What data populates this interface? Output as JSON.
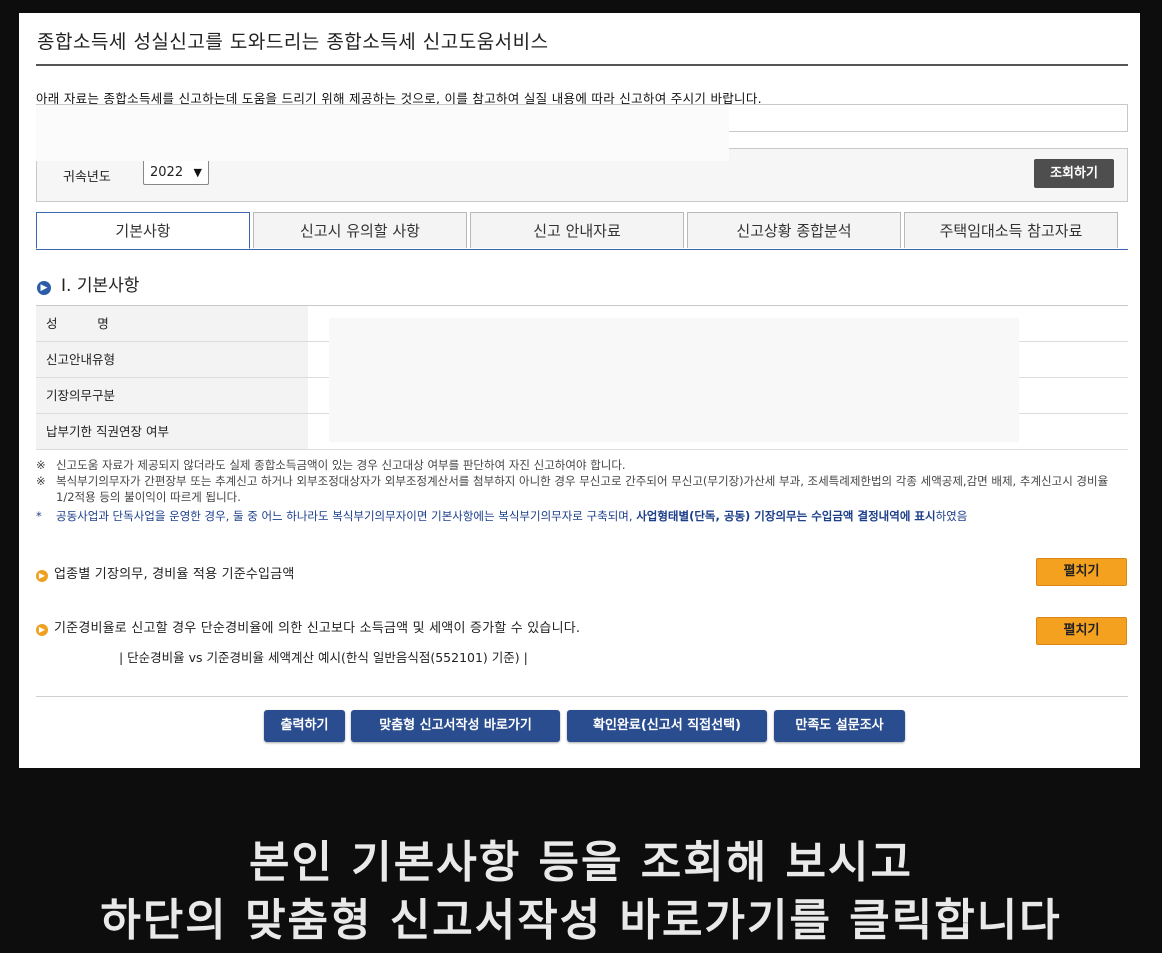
{
  "header": {
    "title": "종합소득세 성실신고를 도와드리는 종합소득세 신고도움서비스"
  },
  "notice": {
    "text": "아래 자료는 종합소득세를 신고하는데 도움을 드리기 위해 제공하는 것으로, 이를 참고하여 실질 내용에 따라 신고하여 주시기 바랍니다."
  },
  "search": {
    "year_label": "귀속년도",
    "year_value": "2022",
    "submit_label": "조회하기"
  },
  "tabs": [
    {
      "label": "기본사항",
      "active": true
    },
    {
      "label": "신고시 유의할 사항",
      "active": false
    },
    {
      "label": "신고 안내자료",
      "active": false
    },
    {
      "label": "신고상황 종합분석",
      "active": false
    },
    {
      "label": "주택임대소득 참고자료",
      "active": false
    }
  ],
  "section": {
    "title": "Ⅰ. 기본사항"
  },
  "basic_info": {
    "rows": [
      {
        "label": "성          명"
      },
      {
        "label": "신고안내유형"
      },
      {
        "label": "기장의무구분"
      },
      {
        "label": "납부기한 직권연장 여부"
      }
    ]
  },
  "notes": {
    "mark1": "※",
    "note1": "신고도움 자료가 제공되지 않더라도 실제 종합소득금액이 있는 경우 신고대상 여부를 판단하여 자진 신고하여야 합니다.",
    "mark2": "※",
    "note2": "복식부기의무자가 간편장부 또는 추계신고 하거나 외부조정대상자가 외부조정계산서를 첨부하지 아니한 경우 무신고로 간주되어 무신고(무기장)가산세 부과, 조세특례제한법의 각종 세액공제,감면 배제, 추계신고시 경비율 1/2적용 등의 불이익이 따르게 됩니다.",
    "mark3": "*",
    "note3_prefix": "공동사업과 단독사업을 운영한 경우, 둘 중 어느 하나라도 복식부기의무자이면 기본사항에는 복식부기의무자로 구축되며,",
    "note3_bold": "사업형태별(단독, 공동) 기장의무는 수입금액 결정내역에 표시",
    "note3_suffix": "하였음"
  },
  "expense_section": {
    "title": "업종별 기장의무, 경비율 적용 기준수입금액",
    "button_label": "펼치기"
  },
  "standard_rate_section": {
    "title": "기준경비율로 신고할 경우 단순경비율에 의한 신고보다 소득금액 및 세액이 증가할 수 있습니다.",
    "button_label": "펼치기",
    "example_link": "| 단순경비율 vs 기준경비율 세액계산 예시(한식 일반음식점(552101) 기준) |"
  },
  "actions": {
    "print": "출력하기",
    "custom_filing": "맞춤형 신고서작성 바로가기",
    "confirm": "확인완료(신고서 직접선택)",
    "survey": "만족도 설문조사"
  },
  "caption": {
    "line1": "본인 기본사항 등을 조회해 보시고",
    "line2": "하단의 맞춤형 신고서작성 바로가기를 클릭합니다"
  },
  "colors": {
    "accent_blue": "#2a4d8f",
    "orange": "#f4a11f",
    "dark_button": "#4e4e4e"
  }
}
